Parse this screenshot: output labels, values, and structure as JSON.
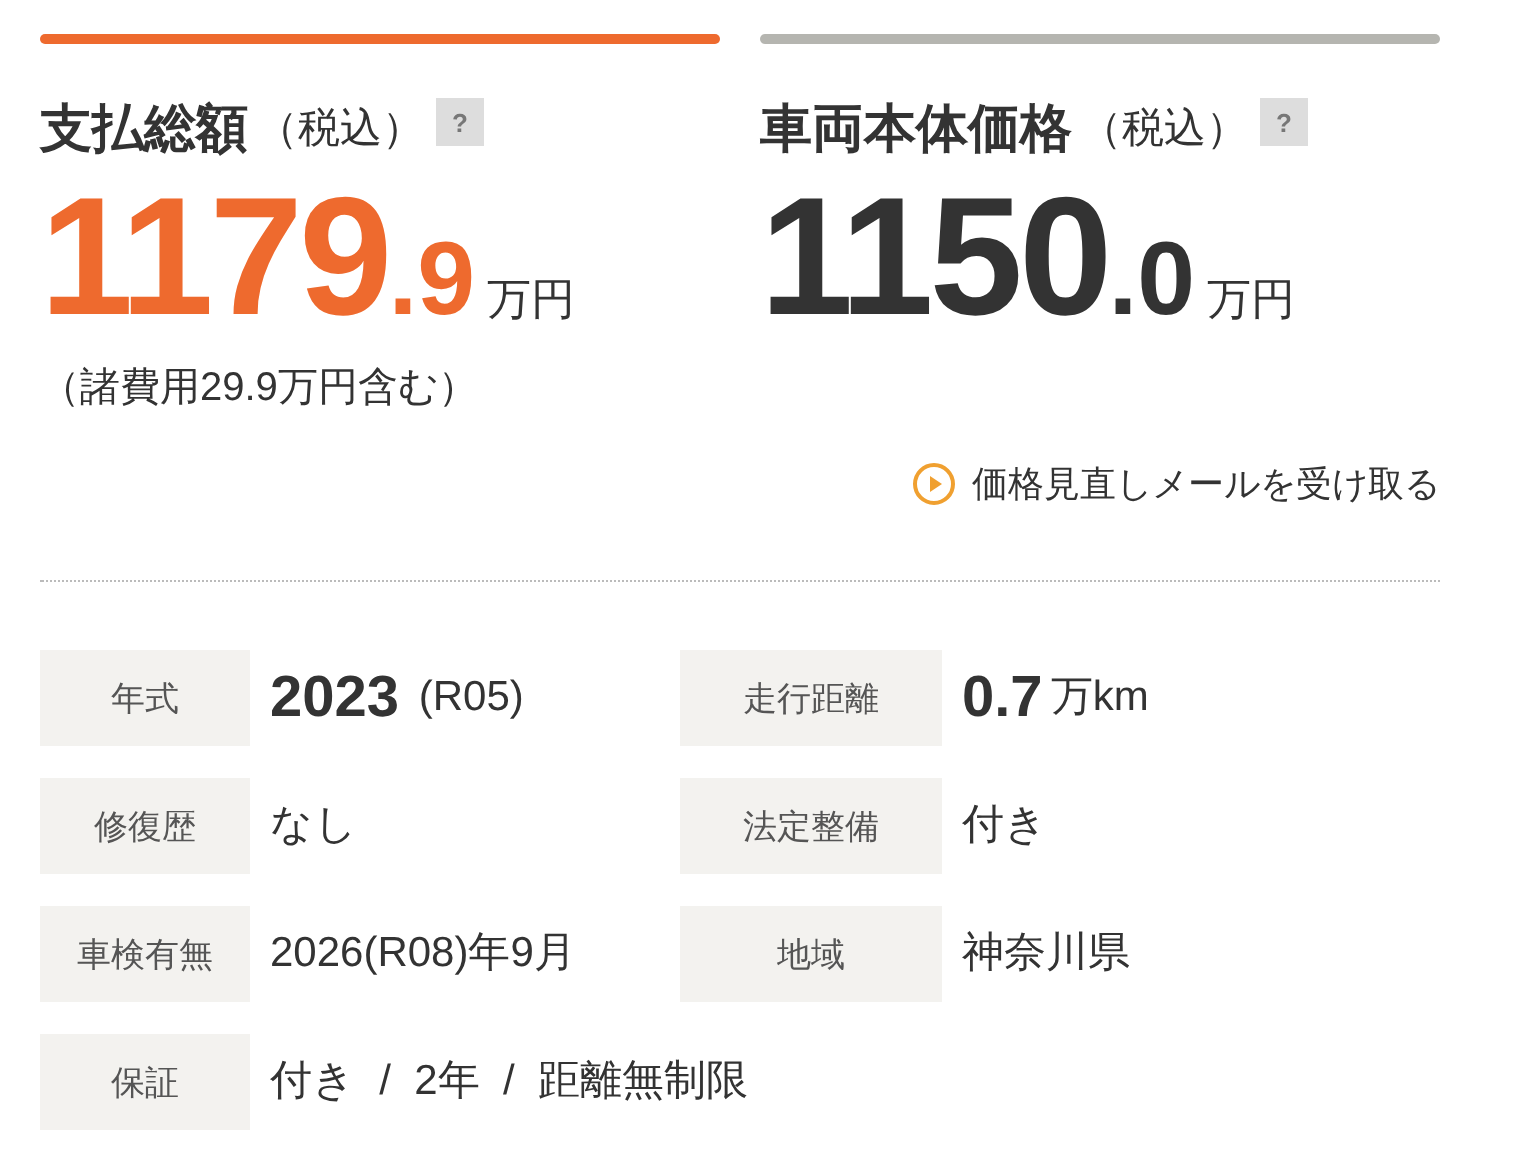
{
  "prices": [
    {
      "title": "支払総額",
      "tax": "（税込）",
      "help": "?",
      "integer": "1179",
      "decimal": ".9",
      "unit": "万円",
      "selected": true,
      "note": "（諸費用29.9万円含む）"
    },
    {
      "title": "車両本体価格",
      "tax": "（税込）",
      "help": "?",
      "integer": "1150",
      "decimal": ".0",
      "unit": "万円",
      "selected": false,
      "link": "価格見直しメールを受け取る"
    }
  ],
  "specs": [
    {
      "label": "年式",
      "value": "**2023** (R05)"
    },
    {
      "label": "走行距離",
      "value": "**0.7**万km"
    },
    {
      "label": "修復歴",
      "value": "なし"
    },
    {
      "label": "法定整備",
      "value": "付き"
    },
    {
      "label": "車検有無",
      "value": "2026(R08)年9月"
    },
    {
      "label": "地域",
      "value": "神奈川県"
    },
    {
      "label": "保証",
      "value": "付き  /  2年  /  距離無制限"
    }
  ]
}
